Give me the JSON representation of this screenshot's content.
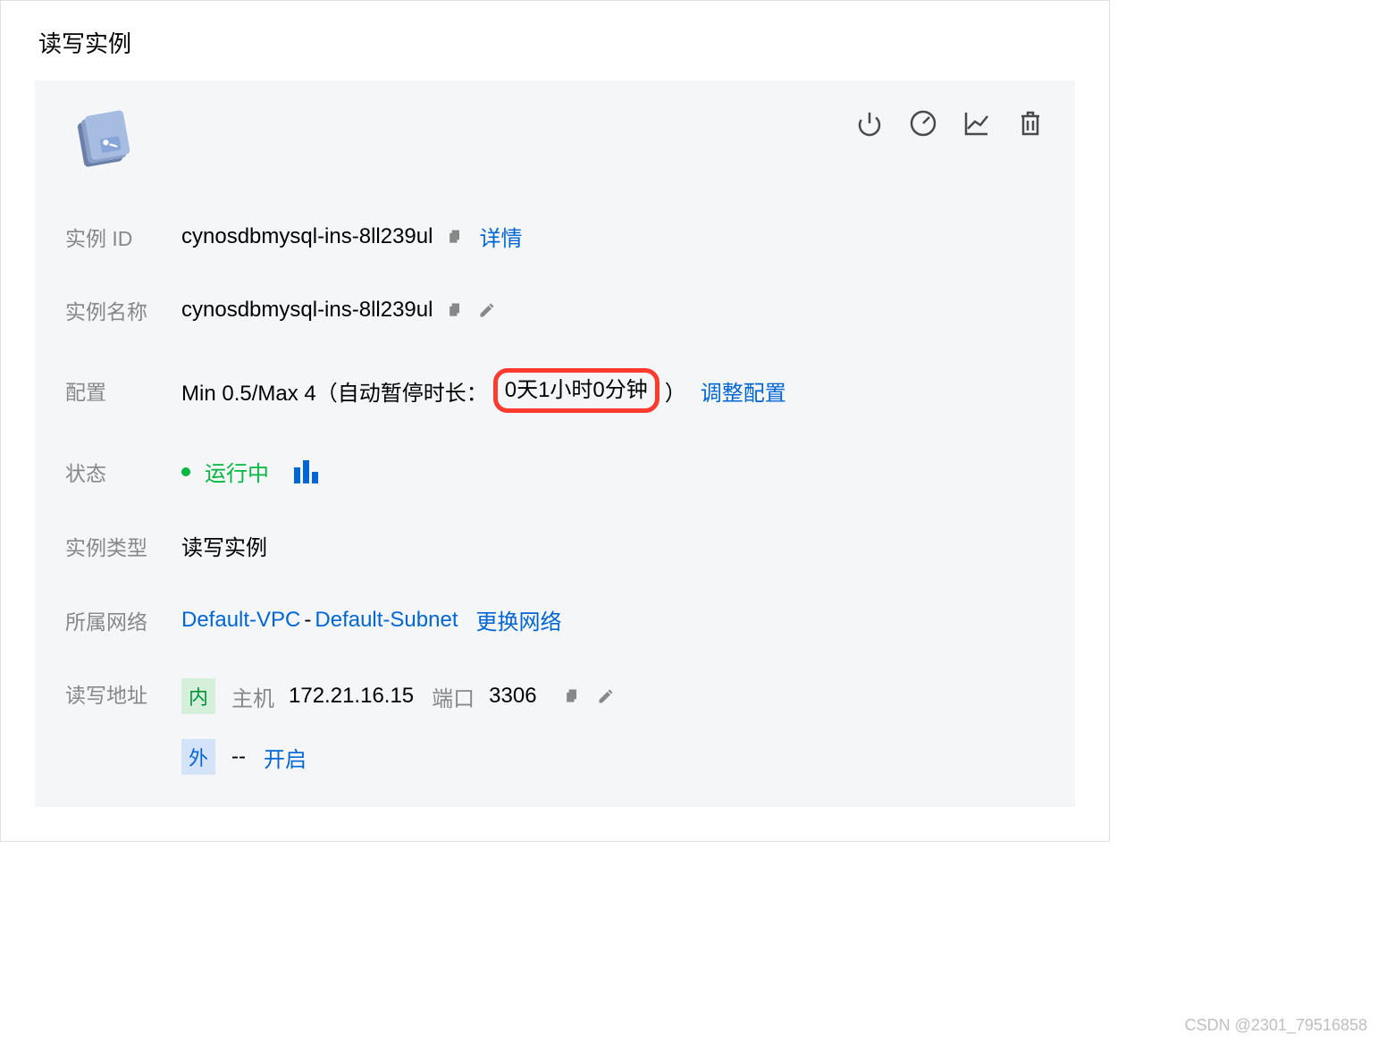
{
  "title": "读写实例",
  "labels": {
    "instance_id": "实例 ID",
    "instance_name": "实例名称",
    "config": "配置",
    "status": "状态",
    "instance_type": "实例类型",
    "network": "所属网络",
    "address": "读写地址"
  },
  "instance": {
    "id": "cynosdbmysql-ins-8ll239ul",
    "name": "cynosdbmysql-ins-8ll239ul",
    "config_prefix": "Min 0.5/Max 4（自动暂停时长：",
    "config_highlighted": "0天1小时0分钟",
    "config_suffix": "）",
    "status_text": "运行中",
    "type": "读写实例",
    "vpc": "Default-VPC",
    "subnet": "Default-Subnet"
  },
  "links": {
    "details": "详情",
    "adjust_config": "调整配置",
    "change_network": "更换网络",
    "enable": "开启"
  },
  "address": {
    "internal_badge": "内",
    "external_badge": "外",
    "host_label": "主机",
    "host": "172.21.16.15",
    "port_label": "端口",
    "port": "3306",
    "external_value": "--"
  },
  "watermark": "CSDN @2301_79516858"
}
